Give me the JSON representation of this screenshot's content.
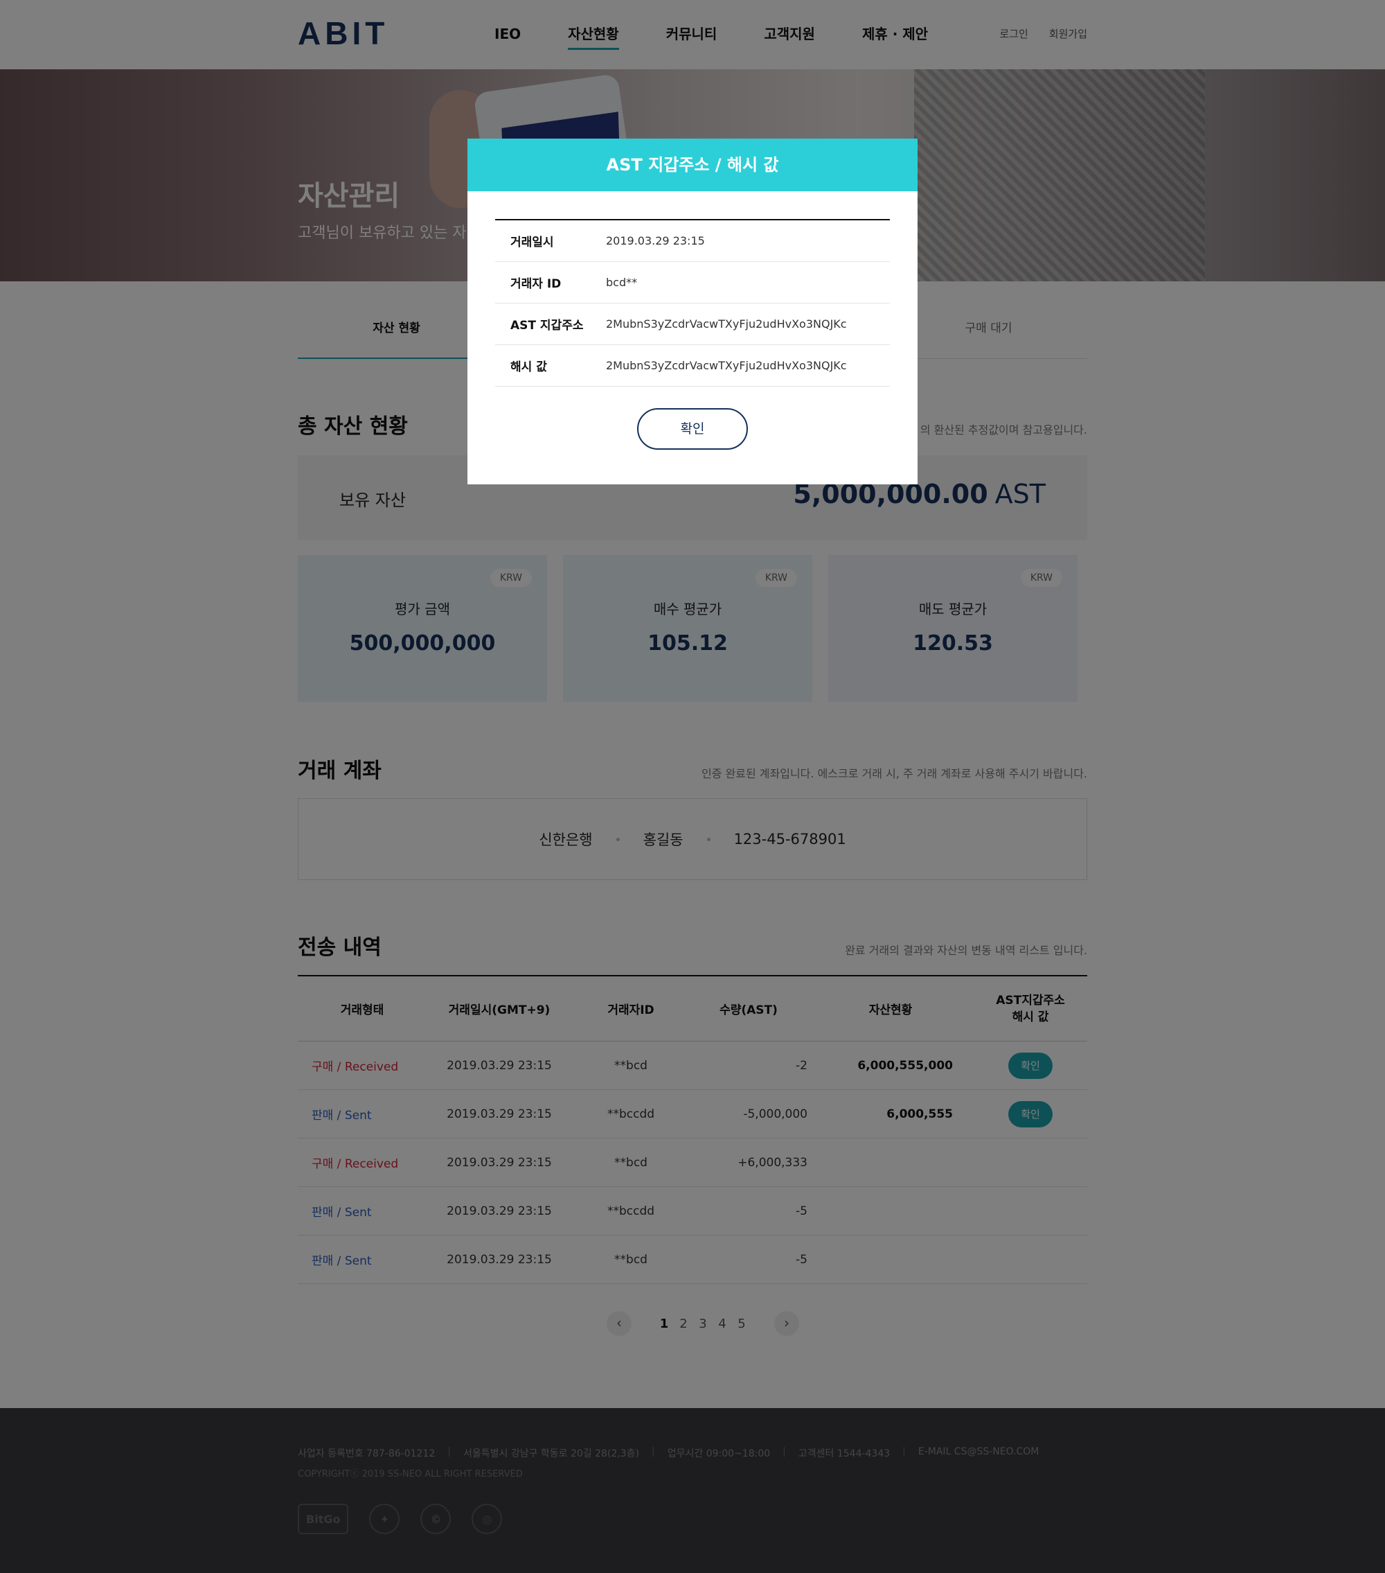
{
  "header": {
    "logo": "ABIT",
    "nav": [
      "IEO",
      "자산현황",
      "커뮤니티",
      "고객지원",
      "제휴 · 제안"
    ],
    "login": "로그인",
    "signup": "회원가입"
  },
  "hero": {
    "title": "자산관리",
    "subtitle": "고객님이 보유하고 있는 자"
  },
  "tabs": [
    {
      "label": "자산 현황",
      "active": true
    },
    {
      "label": "",
      "active": false
    },
    {
      "label": "",
      "active": false
    },
    {
      "label": "구매 대기",
      "active": false
    }
  ],
  "total_assets": {
    "title": "총 자산 현황",
    "desc": "의 환산된 추정값이며 참고용입니다.",
    "holding_label": "보유 자산",
    "holding_value": "5,000,000.00",
    "holding_unit": "AST",
    "cards": [
      {
        "badge": "KRW",
        "label": "평가 금액",
        "value": "500,000,000"
      },
      {
        "badge": "KRW",
        "label": "매수 평균가",
        "value": "105.12"
      },
      {
        "badge": "KRW",
        "label": "매도 평균가",
        "value": "120.53"
      }
    ]
  },
  "account": {
    "title": "거래 계좌",
    "desc": "인증 완료된 계좌입니다. 에스크로 거래 시, 주 거래 계좌로 사용해 주시기 바랍니다.",
    "bank": "신한은행",
    "holder": "홍길동",
    "number": "123-45-678901"
  },
  "history": {
    "title": "전송 내역",
    "desc": "완료 거래의 결과와 자산의 변동 내역 리스트 입니다.",
    "headers": {
      "type": "거래형태",
      "date": "거래일시(GMT+9)",
      "user": "거래자ID",
      "qty": "수량(AST)",
      "balance": "자산현황",
      "addr_line1": "AST지갑주소",
      "addr_line2": "해시 값"
    },
    "confirm_label": "확인",
    "rows": [
      {
        "type": "구매 / Received",
        "kind": "buy",
        "date": "2019.03.29 23:15",
        "user": "**bcd",
        "qty": "-2",
        "balance": "6,000,555,000",
        "has_button": true
      },
      {
        "type": "판매 / Sent",
        "kind": "sell",
        "date": "2019.03.29 23:15",
        "user": "**bccdd",
        "qty": "-5,000,000",
        "balance": "6,000,555",
        "has_button": true
      },
      {
        "type": "구매 / Received",
        "kind": "buy",
        "date": "2019.03.29 23:15",
        "user": "**bcd",
        "qty": "+6,000,333",
        "balance": "",
        "has_button": false
      },
      {
        "type": "판매 / Sent",
        "kind": "sell",
        "date": "2019.03.29 23:15",
        "user": "**bccdd",
        "qty": "-5",
        "balance": "",
        "has_button": false
      },
      {
        "type": "판매 / Sent",
        "kind": "sell",
        "date": "2019.03.29 23:15",
        "user": "**bcd",
        "qty": "-5",
        "balance": "",
        "has_button": false
      }
    ]
  },
  "pagination": {
    "prev": "‹",
    "next": "›",
    "pages": [
      "1",
      "2",
      "3",
      "4",
      "5"
    ],
    "current": "1"
  },
  "footer": {
    "items": [
      "사업자 등록번호 787-86-01212",
      "서울특별시 강남구 학동로 20길 28(2,3층)",
      "업무시간 09:00~18:00",
      "고객센터 1544-4343",
      "E-MAIL CS@SS-NEO.COM"
    ],
    "copyright": "COPYRIGHTⓒ 2019 SS-NEO ALL RIGHT RESERVED",
    "partner_logos": [
      "BitGo"
    ]
  },
  "modal": {
    "title": "AST 지갑주소 / 해시 값",
    "rows": [
      {
        "label": "거래일시",
        "value": "2019.03.29 23:15"
      },
      {
        "label": "거래자 ID",
        "value": "bcd**"
      },
      {
        "label": "AST 지갑주소",
        "value": "2MubnS3yZcdrVacwTXyFju2udHvXo3NQJKc"
      },
      {
        "label": "해시 값",
        "value": "2MubnS3yZcdrVacwTXyFju2udHvXo3NQJKc"
      }
    ],
    "confirm_label": "확인"
  },
  "colors": {
    "accent": "#1aa3ad",
    "modal_header": "#2ccfd7",
    "navy": "#17305a",
    "buy": "#d0223b",
    "sell": "#2b5dbf"
  }
}
